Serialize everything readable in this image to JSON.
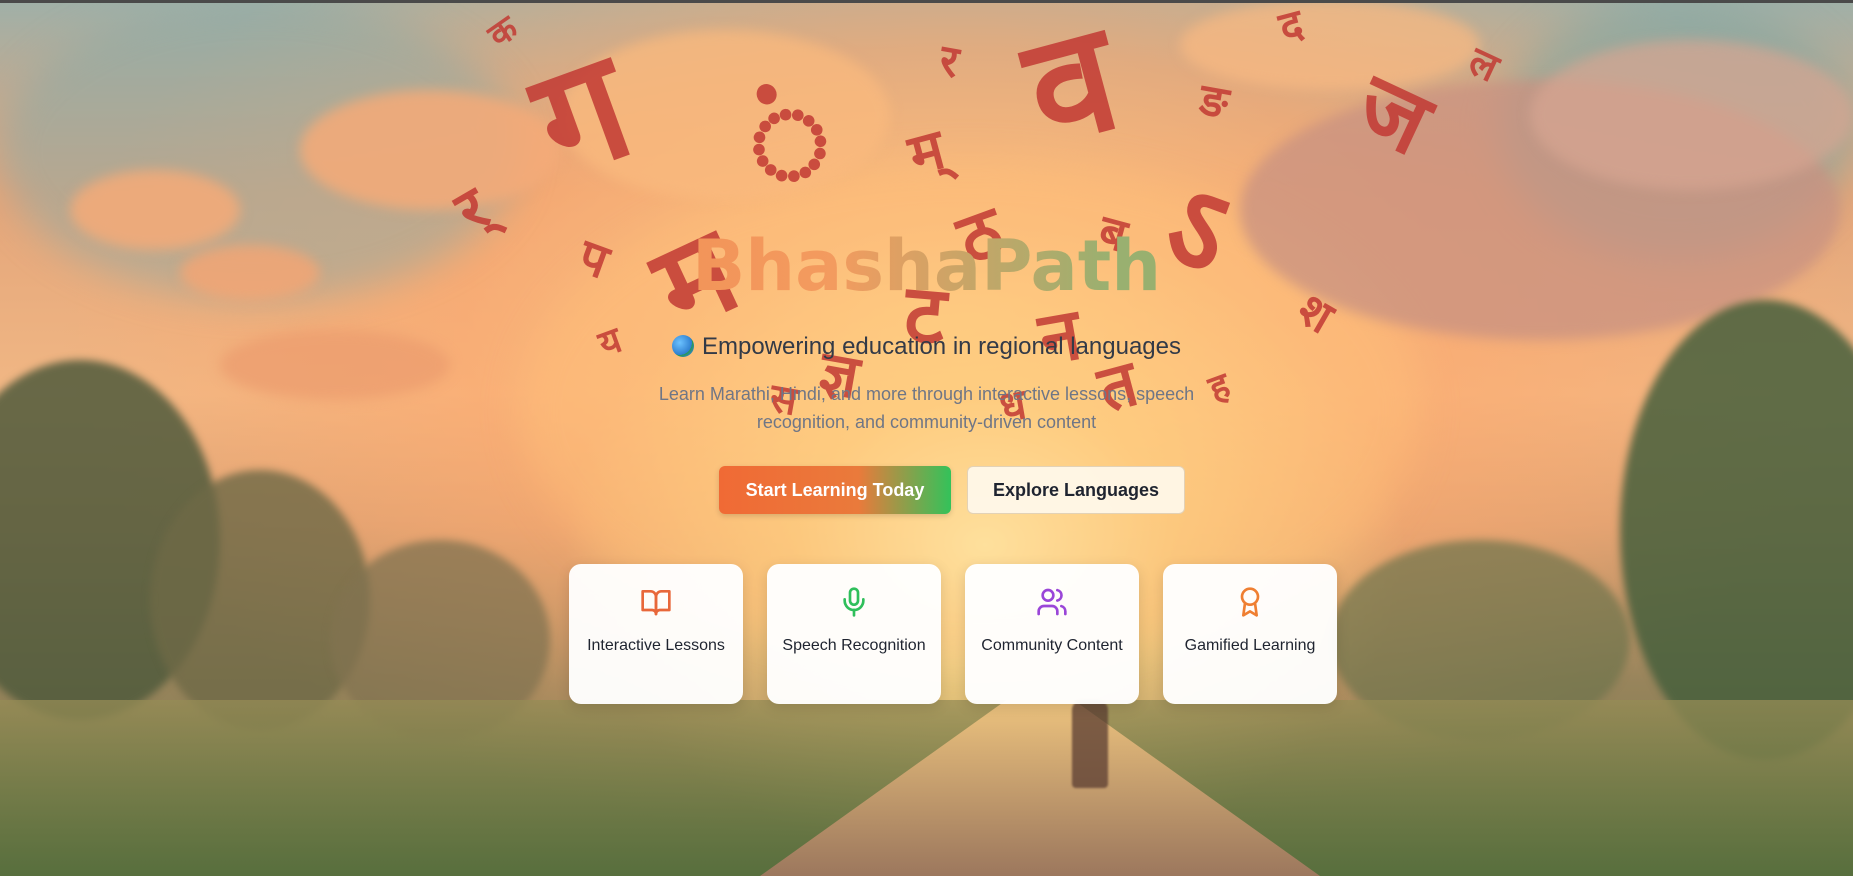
{
  "brand": {
    "name": "BhashaPath",
    "colors": {
      "gradient_start": "#f0743c",
      "gradient_end": "#8ca95f"
    }
  },
  "hero": {
    "tagline_icon": "globe-icon",
    "tagline": "Empowering education in regional languages",
    "description": "Learn Marathi, Hindi, and more through interactive lessons, speech recognition, and community-driven content"
  },
  "actions": {
    "primary_label": "Start Learning Today",
    "secondary_label": "Explore Languages",
    "primary_colors": [
      "#f06a35",
      "#33c25a"
    ]
  },
  "features": [
    {
      "icon": "book-open-icon",
      "label": "Interactive Lessons",
      "color": "#e8673a"
    },
    {
      "icon": "microphone-icon",
      "label": "Speech Recognition",
      "color": "#2fbf5b"
    },
    {
      "icon": "users-icon",
      "label": "Community Content",
      "color": "#9a46d8"
    },
    {
      "icon": "award-icon",
      "label": "Gamified Learning",
      "color": "#ef7f32"
    }
  ],
  "decorative_letters": [
    "ग",
    "ं",
    "व",
    "म",
    "ऽ",
    "र",
    "ट",
    "प",
    "ज",
    "न",
    "ठ",
    "म्",
    "ब",
    "क",
    "ल",
    "द",
    "श",
    "ङ",
    "र्",
    "ज्ञ",
    "त",
    "ह",
    "य",
    "स",
    "ध"
  ]
}
